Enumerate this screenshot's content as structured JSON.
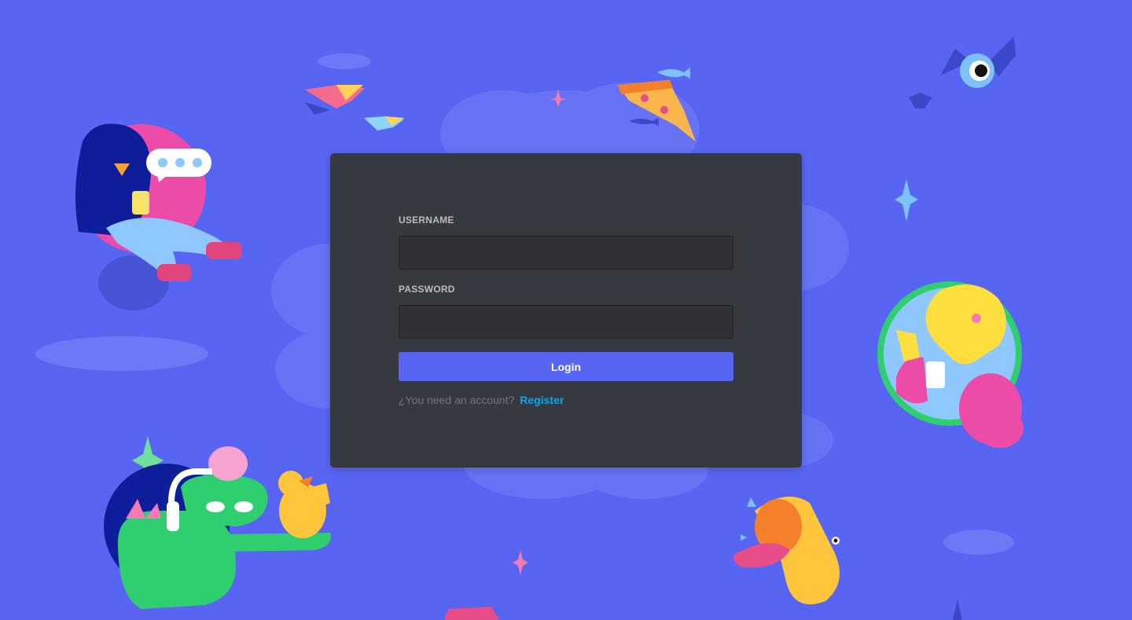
{
  "colors": {
    "background": "#5865f2",
    "card": "#36393f",
    "input": "#303136",
    "button": "#5865f2",
    "link": "#00a8fc"
  },
  "login_form": {
    "username_label": "USERNAME",
    "username_value": "",
    "password_label": "PASSWORD",
    "password_value": "",
    "login_button": "Login",
    "register_prompt": "¿You need an account?",
    "register_link": "Register"
  },
  "illustrations": [
    "person-with-phone-icon",
    "chat-bubble-icon",
    "flying-books-icon",
    "pizza-slice-icon",
    "fish-icon",
    "bat-eyeball-icon",
    "sparkle-icon",
    "yellow-character-portrait-icon",
    "green-crocodile-with-headphones-icon",
    "yellow-duck-icon",
    "singing-trumpet-icon",
    "cloud-icon"
  ]
}
